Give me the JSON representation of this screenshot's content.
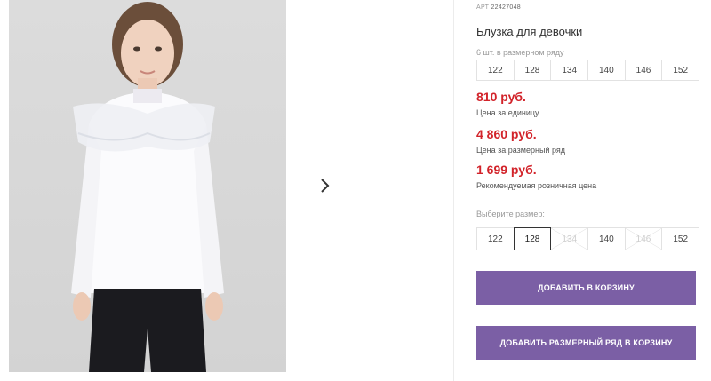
{
  "product": {
    "sku_prefix": "АРТ",
    "sku": "22427048",
    "title": "Блузка для девочки"
  },
  "pack": {
    "label": "6 шт. в размерном ряду",
    "sizes": [
      "122",
      "128",
      "134",
      "140",
      "146",
      "152"
    ]
  },
  "prices": [
    {
      "value": "810 руб.",
      "note": "Цена за единицу"
    },
    {
      "value": "4 860 руб.",
      "note": "Цена за размерный ряд"
    },
    {
      "value": "1 699 руб.",
      "note": "Рекомендуемая розничная цена"
    }
  ],
  "size_select": {
    "label": "Выберите размер:",
    "sizes": [
      {
        "label": "122",
        "state": "available"
      },
      {
        "label": "128",
        "state": "selected"
      },
      {
        "label": "134",
        "state": "unavailable"
      },
      {
        "label": "140",
        "state": "available"
      },
      {
        "label": "146",
        "state": "unavailable"
      },
      {
        "label": "152",
        "state": "available"
      }
    ]
  },
  "buttons": {
    "add_to_cart": "ДОБАВИТЬ В КОРЗИНУ",
    "add_pack_to_cart": "ДОБАВИТЬ РАЗМЕРНЫЙ РЯД В КОРЗИНУ"
  },
  "colors": {
    "price": "#d2232a",
    "button": "#7b5fa5"
  },
  "icons": {
    "next": "chevron-right-icon"
  }
}
